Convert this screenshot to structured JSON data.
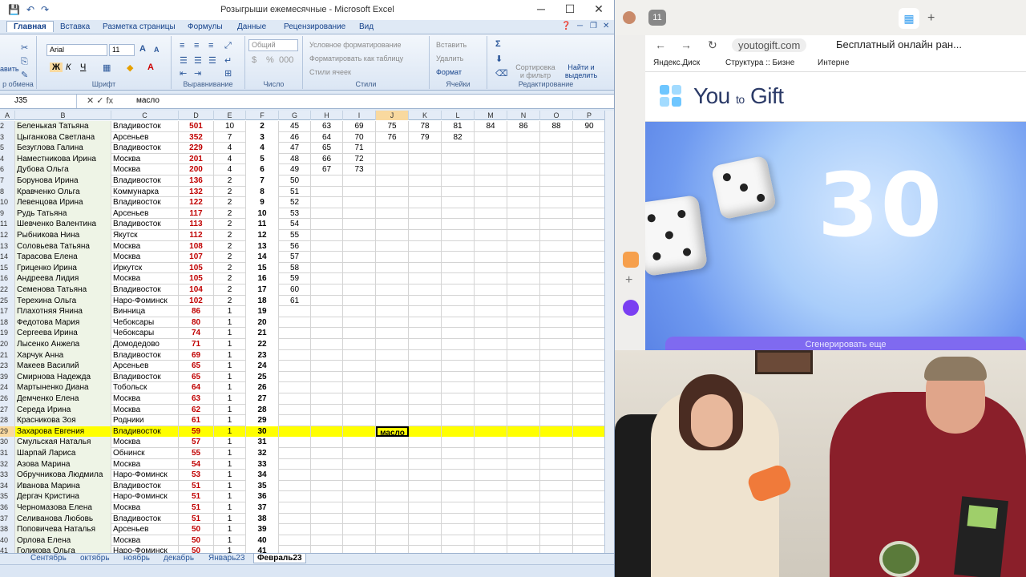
{
  "excel": {
    "window_title": "Розыгрыши ежемесячные - Microsoft Excel",
    "tabs": [
      "Главная",
      "Вставка",
      "Разметка страницы",
      "Формулы",
      "Данные",
      "Рецензирование",
      "Вид"
    ],
    "ribbon": {
      "paste_label": "авить",
      "clipboard_label": "р обмена",
      "font_name": "Arial",
      "font_size": "11",
      "font_group": "Шрифт",
      "align_group": "Выравнивание",
      "number_format": "Общий",
      "number_group": "Число",
      "cond_format": "Условное форматирование",
      "format_table": "Форматировать как таблицу",
      "cell_styles": "Стили ячеек",
      "styles_group": "Стили",
      "insert": "Вставить",
      "delete": "Удалить",
      "format": "Формат",
      "cells_group": "Ячейки",
      "sort_filter": "Сортировка и фильтр",
      "find_select": "Найти и выделить",
      "editing_group": "Редактирование"
    },
    "name_box": "J35",
    "formula_value": "масло",
    "columns": [
      "A",
      "B",
      "C",
      "D",
      "E",
      "F",
      "G",
      "H",
      "I",
      "J",
      "K",
      "L",
      "M",
      "N",
      "O",
      "P"
    ],
    "rows": [
      [
        "2",
        "Беленькая Татьяна",
        "Владивосток",
        "501",
        "10",
        "2",
        "45",
        "63",
        "69",
        "75",
        "78",
        "81",
        "84",
        "86",
        "88",
        "90"
      ],
      [
        "3",
        "Цыганкова Светлана",
        "Арсеньев",
        "352",
        "7",
        "3",
        "46",
        "64",
        "70",
        "76",
        "79",
        "82",
        "",
        "",
        "",
        ""
      ],
      [
        "5",
        "Безуглова Галина",
        "Владивосток",
        "229",
        "4",
        "4",
        "47",
        "65",
        "71",
        "",
        "",
        "",
        "",
        "",
        "",
        ""
      ],
      [
        "4",
        "Наместникова Ирина",
        "Москва",
        "201",
        "4",
        "5",
        "48",
        "66",
        "72",
        "",
        "",
        "",
        "",
        "",
        "",
        ""
      ],
      [
        "6",
        "Дубова Ольга",
        "Москва",
        "200",
        "4",
        "6",
        "49",
        "67",
        "73",
        "",
        "",
        "",
        "",
        "",
        "",
        ""
      ],
      [
        "7",
        "Борунова Ирина",
        "Владивосток",
        "136",
        "2",
        "7",
        "50",
        "",
        "",
        "",
        "",
        "",
        "",
        "",
        "",
        ""
      ],
      [
        "8",
        "Кравченко Ольга",
        "Коммунарка",
        "132",
        "2",
        "8",
        "51",
        "",
        "",
        "",
        "",
        "",
        "",
        "",
        "",
        ""
      ],
      [
        "10",
        "Левенцова Ирина",
        "Владивосток",
        "122",
        "2",
        "9",
        "52",
        "",
        "",
        "",
        "",
        "",
        "",
        "",
        "",
        ""
      ],
      [
        "9",
        "Рудь Татьяна",
        "Арсеньев",
        "117",
        "2",
        "10",
        "53",
        "",
        "",
        "",
        "",
        "",
        "",
        "",
        "",
        ""
      ],
      [
        "11",
        "Шевченко Валентина",
        "Владивосток",
        "113",
        "2",
        "11",
        "54",
        "",
        "",
        "",
        "",
        "",
        "",
        "",
        "",
        ""
      ],
      [
        "12",
        "Рыбникова Нина",
        "Якутск",
        "112",
        "2",
        "12",
        "55",
        "",
        "",
        "",
        "",
        "",
        "",
        "",
        "",
        ""
      ],
      [
        "13",
        "Соловьева Татьяна",
        "Москва",
        "108",
        "2",
        "13",
        "56",
        "",
        "",
        "",
        "",
        "",
        "",
        "",
        "",
        ""
      ],
      [
        "14",
        "Тарасова Елена",
        "Москва",
        "107",
        "2",
        "14",
        "57",
        "",
        "",
        "",
        "",
        "",
        "",
        "",
        "",
        ""
      ],
      [
        "15",
        "Гриценко Ирина",
        "Иркутск",
        "105",
        "2",
        "15",
        "58",
        "",
        "",
        "",
        "",
        "",
        "",
        "",
        "",
        ""
      ],
      [
        "16",
        "Андреева Лидия",
        "Москва",
        "105",
        "2",
        "16",
        "59",
        "",
        "",
        "",
        "",
        "",
        "",
        "",
        "",
        ""
      ],
      [
        "22",
        "Семенова Татьяна",
        "Владивосток",
        "104",
        "2",
        "17",
        "60",
        "",
        "",
        "",
        "",
        "",
        "",
        "",
        "",
        ""
      ],
      [
        "25",
        "Терехина Ольга",
        "Наро-Фоминск",
        "102",
        "2",
        "18",
        "61",
        "",
        "",
        "",
        "",
        "",
        "",
        "",
        "",
        ""
      ],
      [
        "17",
        "Плахотняя Янина",
        "Винница",
        "86",
        "1",
        "19",
        "",
        "",
        "",
        "",
        "",
        "",
        "",
        "",
        "",
        ""
      ],
      [
        "18",
        "Федотова Мария",
        "Чебоксары",
        "80",
        "1",
        "20",
        "",
        "",
        "",
        "",
        "",
        "",
        "",
        "",
        "",
        ""
      ],
      [
        "19",
        "Сергеева Ирина",
        "Чебоксары",
        "74",
        "1",
        "21",
        "",
        "",
        "",
        "",
        "",
        "",
        "",
        "",
        "",
        ""
      ],
      [
        "20",
        "Лысенко Анжела",
        "Домодедово",
        "71",
        "1",
        "22",
        "",
        "",
        "",
        "",
        "",
        "",
        "",
        "",
        "",
        ""
      ],
      [
        "21",
        "Харчук Анна",
        "Владивосток",
        "69",
        "1",
        "23",
        "",
        "",
        "",
        "",
        "",
        "",
        "",
        "",
        "",
        ""
      ],
      [
        "23",
        "Макеев Василий",
        "Арсеньев",
        "65",
        "1",
        "24",
        "",
        "",
        "",
        "",
        "",
        "",
        "",
        "",
        "",
        ""
      ],
      [
        "39",
        "Смирнова Надежда",
        "Владивосток",
        "65",
        "1",
        "25",
        "",
        "",
        "",
        "",
        "",
        "",
        "",
        "",
        "",
        ""
      ],
      [
        "24",
        "Мартыненко Диана",
        "Тобольск",
        "64",
        "1",
        "26",
        "",
        "",
        "",
        "",
        "",
        "",
        "",
        "",
        "",
        ""
      ],
      [
        "26",
        "Демченко Елена",
        "Москва",
        "63",
        "1",
        "27",
        "",
        "",
        "",
        "",
        "",
        "",
        "",
        "",
        "",
        ""
      ],
      [
        "27",
        "Середа Ирина",
        "Москва",
        "62",
        "1",
        "28",
        "",
        "",
        "",
        "",
        "",
        "",
        "",
        "",
        "",
        ""
      ],
      [
        "28",
        "Красникова Зоя",
        "Родники",
        "61",
        "1",
        "29",
        "",
        "",
        "",
        "",
        "",
        "",
        "",
        "",
        "",
        ""
      ],
      [
        "29",
        "Захарова Евгения",
        "Владивосток",
        "59",
        "1",
        "30",
        "",
        "",
        "",
        "масло",
        "",
        "",
        "",
        "",
        "",
        ""
      ],
      [
        "30",
        "Смульская Наталья",
        "Москва",
        "57",
        "1",
        "31",
        "",
        "",
        "",
        "",
        "",
        "",
        "",
        "",
        "",
        ""
      ],
      [
        "31",
        "Шарпай Лариса",
        "Обнинск",
        "55",
        "1",
        "32",
        "",
        "",
        "",
        "",
        "",
        "",
        "",
        "",
        "",
        ""
      ],
      [
        "32",
        "Азова Марина",
        "Москва",
        "54",
        "1",
        "33",
        "",
        "",
        "",
        "",
        "",
        "",
        "",
        "",
        "",
        ""
      ],
      [
        "33",
        "Обручникова Людмила",
        "Наро-Фоминск",
        "53",
        "1",
        "34",
        "",
        "",
        "",
        "",
        "",
        "",
        "",
        "",
        "",
        ""
      ],
      [
        "34",
        "Иванова Марина",
        "Владивосток",
        "51",
        "1",
        "35",
        "",
        "",
        "",
        "",
        "",
        "",
        "",
        "",
        "",
        ""
      ],
      [
        "35",
        "Дергач Кристина",
        "Наро-Фоминск",
        "51",
        "1",
        "36",
        "",
        "",
        "",
        "",
        "",
        "",
        "",
        "",
        "",
        ""
      ],
      [
        "36",
        "Черномазова Елена",
        "Москва",
        "51",
        "1",
        "37",
        "",
        "",
        "",
        "",
        "",
        "",
        "",
        "",
        "",
        ""
      ],
      [
        "37",
        "Селиванова Любовь",
        "Владивосток",
        "51",
        "1",
        "38",
        "",
        "",
        "",
        "",
        "",
        "",
        "",
        "",
        "",
        ""
      ],
      [
        "38",
        "Поповичева Наталья",
        "Арсеньев",
        "50",
        "1",
        "39",
        "",
        "",
        "",
        "",
        "",
        "",
        "",
        "",
        "",
        ""
      ],
      [
        "40",
        "Орлова Елена",
        "Москва",
        "50",
        "1",
        "40",
        "",
        "",
        "",
        "",
        "",
        "",
        "",
        "",
        "",
        ""
      ],
      [
        "41",
        "Голикова Ольга",
        "Наро-Фоминск",
        "50",
        "1",
        "41",
        "",
        "",
        "",
        "",
        "",
        "",
        "",
        "",
        "",
        ""
      ]
    ],
    "highlight_row_index": 28,
    "sheet_tabs": [
      "Сентябрь",
      "октябрь",
      "ноябрь",
      "декабрь",
      "Январь23",
      "Февраль23"
    ],
    "active_sheet": "Февраль23"
  },
  "browser": {
    "tab_count": "11",
    "url": "youtogift.com",
    "page_title": "Бесплатный онлайн ран...",
    "bookmarks": [
      "Яндекс.Диск",
      "Структура :: Бизне",
      "Интерне"
    ],
    "brand_name": "You",
    "brand_to": "to",
    "brand_gift": "Gift",
    "dice_number": "30",
    "roll_button": "Сгенерировать еще"
  }
}
